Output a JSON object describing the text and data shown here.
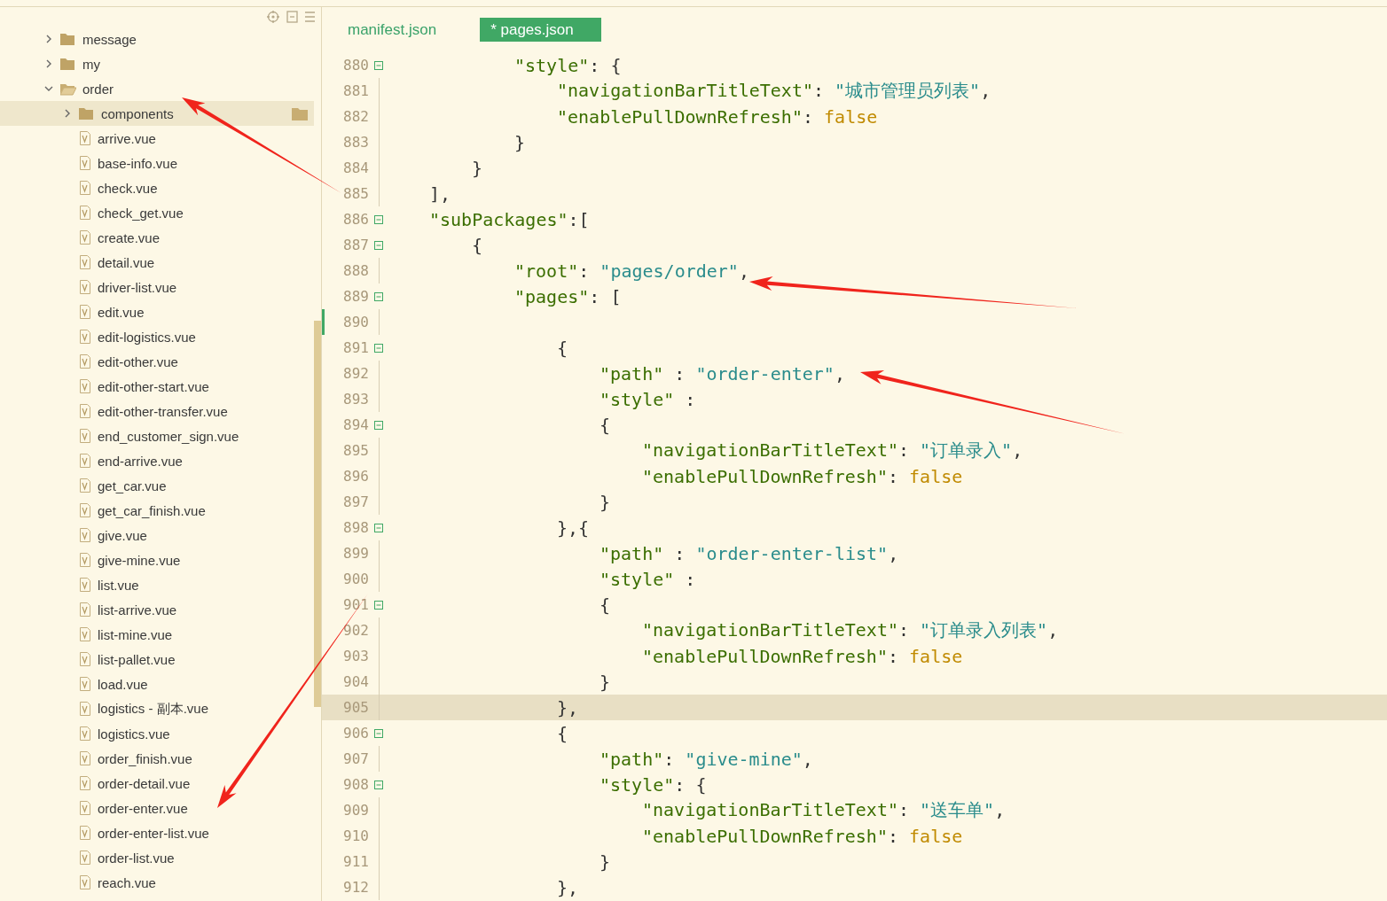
{
  "sidebar": {
    "tree": [
      {
        "name": "message",
        "kind": "folder",
        "expanded": false,
        "selected": false
      },
      {
        "name": "my",
        "kind": "folder",
        "expanded": false,
        "selected": false
      },
      {
        "name": "order",
        "kind": "folder",
        "expanded": true,
        "selected": false,
        "children": [
          {
            "name": "components",
            "kind": "folder",
            "expanded": false,
            "selected": true
          },
          {
            "name": "arrive.vue",
            "kind": "file",
            "selected": false
          },
          {
            "name": "base-info.vue",
            "kind": "file",
            "selected": false
          },
          {
            "name": "check.vue",
            "kind": "file",
            "selected": false
          },
          {
            "name": "check_get.vue",
            "kind": "file",
            "selected": false
          },
          {
            "name": "create.vue",
            "kind": "file",
            "selected": false
          },
          {
            "name": "detail.vue",
            "kind": "file",
            "selected": false
          },
          {
            "name": "driver-list.vue",
            "kind": "file",
            "selected": false
          },
          {
            "name": "edit.vue",
            "kind": "file",
            "selected": false
          },
          {
            "name": "edit-logistics.vue",
            "kind": "file",
            "selected": false
          },
          {
            "name": "edit-other.vue",
            "kind": "file",
            "selected": false
          },
          {
            "name": "edit-other-start.vue",
            "kind": "file",
            "selected": false
          },
          {
            "name": "edit-other-transfer.vue",
            "kind": "file",
            "selected": false
          },
          {
            "name": "end_customer_sign.vue",
            "kind": "file",
            "selected": false
          },
          {
            "name": "end-arrive.vue",
            "kind": "file",
            "selected": false
          },
          {
            "name": "get_car.vue",
            "kind": "file",
            "selected": false
          },
          {
            "name": "get_car_finish.vue",
            "kind": "file",
            "selected": false
          },
          {
            "name": "give.vue",
            "kind": "file",
            "selected": false
          },
          {
            "name": "give-mine.vue",
            "kind": "file",
            "selected": false
          },
          {
            "name": "list.vue",
            "kind": "file",
            "selected": false
          },
          {
            "name": "list-arrive.vue",
            "kind": "file",
            "selected": false
          },
          {
            "name": "list-mine.vue",
            "kind": "file",
            "selected": false
          },
          {
            "name": "list-pallet.vue",
            "kind": "file",
            "selected": false
          },
          {
            "name": "load.vue",
            "kind": "file",
            "selected": false
          },
          {
            "name": "logistics - 副本.vue",
            "kind": "file",
            "selected": false
          },
          {
            "name": "logistics.vue",
            "kind": "file",
            "selected": false
          },
          {
            "name": "order_finish.vue",
            "kind": "file",
            "selected": false
          },
          {
            "name": "order-detail.vue",
            "kind": "file",
            "selected": false
          },
          {
            "name": "order-enter.vue",
            "kind": "file",
            "selected": false
          },
          {
            "name": "order-enter-list.vue",
            "kind": "file",
            "selected": false
          },
          {
            "name": "order-list.vue",
            "kind": "file",
            "selected": false
          },
          {
            "name": "reach.vue",
            "kind": "file",
            "selected": false
          }
        ]
      }
    ]
  },
  "editor": {
    "tabs": [
      {
        "label": "manifest.json",
        "selected": false
      },
      {
        "label": "* pages.json",
        "selected": true
      }
    ],
    "lines": [
      {
        "number": "880",
        "fold": true,
        "current": false,
        "tokens": [
          {
            "kind": "key",
            "text": "\"style\""
          },
          {
            "kind": "punct",
            "text": ": {"
          }
        ]
      },
      {
        "number": "881",
        "fold": false,
        "current": false,
        "tokens": [
          {
            "kind": "key",
            "text": "\"navigationBarTitleText\""
          },
          {
            "kind": "punct",
            "text": ": "
          },
          {
            "kind": "string",
            "text": "\"城市管理员列表\""
          },
          {
            "kind": "punct",
            "text": ","
          }
        ]
      },
      {
        "number": "882",
        "fold": false,
        "current": false,
        "tokens": [
          {
            "kind": "key",
            "text": "\"enablePullDownRefresh\""
          },
          {
            "kind": "punct",
            "text": ": "
          },
          {
            "kind": "bool",
            "text": "false"
          }
        ]
      },
      {
        "number": "883",
        "fold": false,
        "current": false,
        "tokens": [
          {
            "kind": "punct",
            "text": "}"
          }
        ]
      },
      {
        "number": "884",
        "fold": false,
        "current": false,
        "tokens": [
          {
            "kind": "punct",
            "text": "}"
          }
        ]
      },
      {
        "number": "885",
        "fold": false,
        "current": false,
        "tokens": [
          {
            "kind": "punct",
            "text": "],"
          }
        ]
      },
      {
        "number": "886",
        "fold": true,
        "current": false,
        "tokens": [
          {
            "kind": "key",
            "text": "\"subPackages\""
          },
          {
            "kind": "punct",
            "text": ":["
          }
        ]
      },
      {
        "number": "887",
        "fold": true,
        "current": false,
        "tokens": [
          {
            "kind": "punct",
            "text": "{"
          }
        ]
      },
      {
        "number": "888",
        "fold": false,
        "current": false,
        "tokens": [
          {
            "kind": "key",
            "text": "\"root\""
          },
          {
            "kind": "punct",
            "text": ": "
          },
          {
            "kind": "string",
            "text": "\"pages/order\""
          },
          {
            "kind": "punct",
            "text": ","
          }
        ]
      },
      {
        "number": "889",
        "fold": true,
        "current": false,
        "tokens": [
          {
            "kind": "key",
            "text": "\"pages\""
          },
          {
            "kind": "punct",
            "text": ": ["
          }
        ]
      },
      {
        "number": "890",
        "fold": false,
        "current": false,
        "modified": true
      },
      {
        "number": "891",
        "fold": true,
        "current": false,
        "tokens": [
          {
            "kind": "punct",
            "text": "{"
          }
        ]
      },
      {
        "number": "892",
        "fold": false,
        "current": false,
        "tokens": [
          {
            "kind": "key",
            "text": "\"path\""
          },
          {
            "kind": "punct",
            "text": " : "
          },
          {
            "kind": "string",
            "text": "\"order-enter\""
          },
          {
            "kind": "punct",
            "text": ","
          }
        ]
      },
      {
        "number": "893",
        "fold": false,
        "current": false,
        "tokens": [
          {
            "kind": "key",
            "text": "\"style\""
          },
          {
            "kind": "punct",
            "text": " :"
          }
        ]
      },
      {
        "number": "894",
        "fold": true,
        "current": false,
        "tokens": [
          {
            "kind": "punct",
            "text": "{"
          }
        ]
      },
      {
        "number": "895",
        "fold": false,
        "current": false,
        "tokens": [
          {
            "kind": "key",
            "text": "\"navigationBarTitleText\""
          },
          {
            "kind": "punct",
            "text": ": "
          },
          {
            "kind": "string",
            "text": "\"订单录入\""
          },
          {
            "kind": "punct",
            "text": ","
          }
        ]
      },
      {
        "number": "896",
        "fold": false,
        "current": false,
        "tokens": [
          {
            "kind": "key",
            "text": "\"enablePullDownRefresh\""
          },
          {
            "kind": "punct",
            "text": ": "
          },
          {
            "kind": "bool",
            "text": "false"
          }
        ]
      },
      {
        "number": "897",
        "fold": false,
        "current": false,
        "tokens": [
          {
            "kind": "punct",
            "text": "}"
          }
        ]
      },
      {
        "number": "898",
        "fold": true,
        "current": false,
        "tokens": [
          {
            "kind": "punct",
            "text": "},{"
          }
        ]
      },
      {
        "number": "899",
        "fold": false,
        "current": false,
        "tokens": [
          {
            "kind": "key",
            "text": "\"path\""
          },
          {
            "kind": "punct",
            "text": " : "
          },
          {
            "kind": "string",
            "text": "\"order-enter-list\""
          },
          {
            "kind": "punct",
            "text": ","
          }
        ]
      },
      {
        "number": "900",
        "fold": false,
        "current": false,
        "tokens": [
          {
            "kind": "key",
            "text": "\"style\""
          },
          {
            "kind": "punct",
            "text": " :"
          }
        ]
      },
      {
        "number": "901",
        "fold": true,
        "current": false,
        "tokens": [
          {
            "kind": "punct",
            "text": "{"
          }
        ]
      },
      {
        "number": "902",
        "fold": false,
        "current": false,
        "tokens": [
          {
            "kind": "key",
            "text": "\"navigationBarTitleText\""
          },
          {
            "kind": "punct",
            "text": ": "
          },
          {
            "kind": "string",
            "text": "\"订单录入列表\""
          },
          {
            "kind": "punct",
            "text": ","
          }
        ]
      },
      {
        "number": "903",
        "fold": false,
        "current": false,
        "tokens": [
          {
            "kind": "key",
            "text": "\"enablePullDownRefresh\""
          },
          {
            "kind": "punct",
            "text": ": "
          },
          {
            "kind": "bool",
            "text": "false"
          }
        ]
      },
      {
        "number": "904",
        "fold": false,
        "current": false,
        "tokens": [
          {
            "kind": "punct",
            "text": "}"
          }
        ]
      },
      {
        "number": "905",
        "fold": false,
        "current": true,
        "tokens": [
          {
            "kind": "punct",
            "text": "},"
          }
        ]
      },
      {
        "number": "906",
        "fold": true,
        "current": false,
        "tokens": [
          {
            "kind": "punct",
            "text": "{"
          }
        ]
      },
      {
        "number": "907",
        "fold": false,
        "current": false,
        "tokens": [
          {
            "kind": "key",
            "text": "\"path\""
          },
          {
            "kind": "punct",
            "text": ": "
          },
          {
            "kind": "string",
            "text": "\"give-mine\""
          },
          {
            "kind": "punct",
            "text": ","
          }
        ]
      },
      {
        "number": "908",
        "fold": true,
        "current": false,
        "tokens": [
          {
            "kind": "key",
            "text": "\"style\""
          },
          {
            "kind": "punct",
            "text": ": {"
          }
        ]
      },
      {
        "number": "909",
        "fold": false,
        "current": false,
        "tokens": [
          {
            "kind": "key",
            "text": "\"navigationBarTitleText\""
          },
          {
            "kind": "punct",
            "text": ": "
          },
          {
            "kind": "string",
            "text": "\"送车单\""
          },
          {
            "kind": "punct",
            "text": ","
          }
        ]
      },
      {
        "number": "910",
        "fold": false,
        "current": false,
        "tokens": [
          {
            "kind": "key",
            "text": "\"enablePullDownRefresh\""
          },
          {
            "kind": "punct",
            "text": ": "
          },
          {
            "kind": "bool",
            "text": "false"
          }
        ]
      },
      {
        "number": "911",
        "fold": false,
        "current": false,
        "tokens": [
          {
            "kind": "punct",
            "text": "}"
          }
        ]
      },
      {
        "number": "912",
        "fold": false,
        "current": false,
        "tokens": [
          {
            "kind": "punct",
            "text": "},"
          }
        ]
      }
    ]
  }
}
